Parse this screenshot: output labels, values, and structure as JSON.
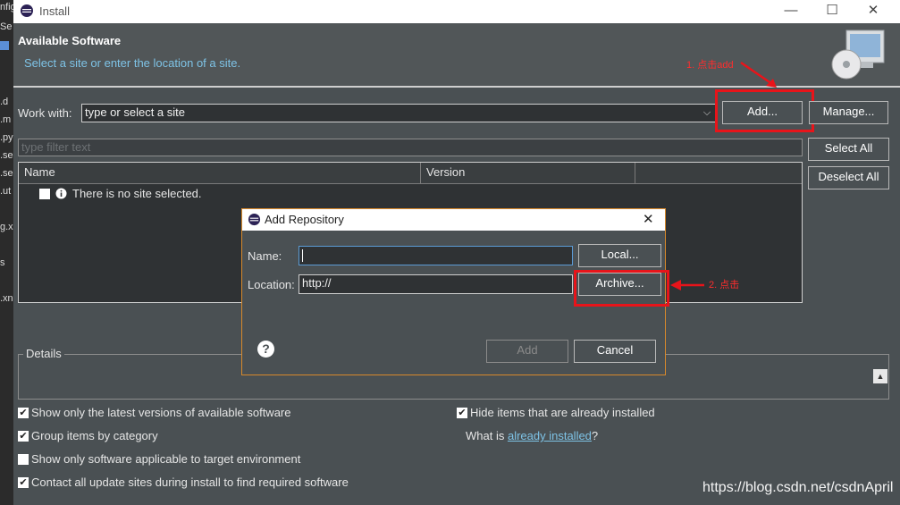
{
  "window": {
    "title": "Install",
    "minimize": "—",
    "maximize": "☐",
    "close": "✕"
  },
  "left_strip": [
    "nfig",
    "Se",
    "",
    ".d",
    ".m",
    ".py",
    ".se",
    ".se",
    ".ut",
    "g.x",
    "s",
    ".xn"
  ],
  "header": {
    "title": "Available Software",
    "subtitle": "Select a site or enter the location of a site."
  },
  "work_with": {
    "label": "Work with:",
    "value": "type or select a site",
    "add_button": "Add...",
    "manage_button": "Manage..."
  },
  "filter": {
    "placeholder": "type filter text"
  },
  "side_buttons": {
    "select_all": "Select All",
    "deselect_all": "Deselect All"
  },
  "table": {
    "columns": [
      "Name",
      "Version",
      ""
    ],
    "rows": [
      {
        "text": "There is no site selected."
      }
    ]
  },
  "details": {
    "label": "Details"
  },
  "options": [
    {
      "label": "Show only the latest versions of available software",
      "checked": true
    },
    {
      "label": "Group items by category",
      "checked": true
    },
    {
      "label": "Show only software applicable to target environment",
      "checked": false
    },
    {
      "label": "Contact all update sites during install to find required software",
      "checked": true
    }
  ],
  "right_options": {
    "hide_installed": {
      "label": "Hide items that are already installed",
      "checked": true
    },
    "what_is_prefix": "What is ",
    "what_is_link": "already installed",
    "what_is_suffix": "?"
  },
  "dialog": {
    "title": "Add Repository",
    "close": "✕",
    "name_label": "Name:",
    "name_value": "",
    "location_label": "Location:",
    "location_value": "http://",
    "local_button": "Local...",
    "archive_button": "Archive...",
    "add_button": "Add",
    "cancel_button": "Cancel",
    "help": "?"
  },
  "annotations": {
    "step1": "1. 点击add",
    "step2": "2. 点击"
  },
  "watermark": "https://blog.csdn.net/csdnApril",
  "colors": {
    "accent_red": "#e8141a",
    "link": "#7ec3e6",
    "dialog_border": "#d8892b"
  }
}
